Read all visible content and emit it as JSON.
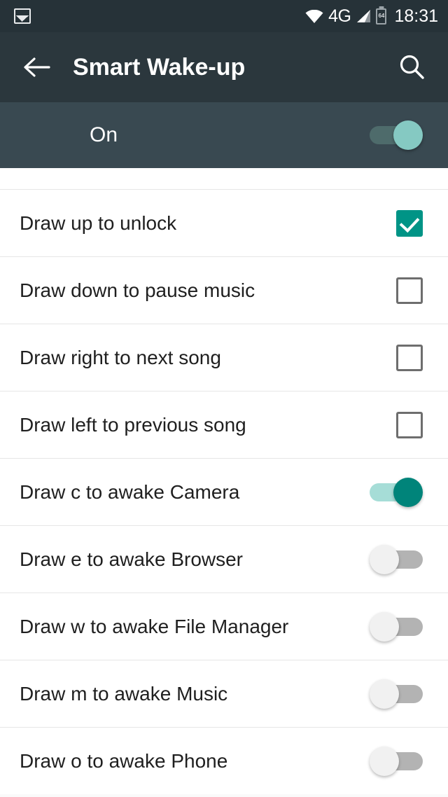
{
  "status_bar": {
    "notification_icon": "image-icon",
    "wifi_icon": "wifi-icon",
    "network_label": "4G",
    "signal_icon": "signal-bars-icon",
    "battery_icon": "battery-icon",
    "battery_level": "64",
    "time": "18:31"
  },
  "toolbar": {
    "back_icon": "back-arrow-icon",
    "title": "Smart Wake-up",
    "search_icon": "search-icon"
  },
  "master": {
    "label": "On",
    "state": "on"
  },
  "colors": {
    "status_bar_bg": "#263238",
    "toolbar_bg": "#2b373d",
    "master_band_bg": "#394951",
    "accent_teal": "#009486",
    "toggle_on_knob": "#00847a",
    "toggle_on_track": "#a6ddd7",
    "toggle_off_track": "#b3b3b3",
    "toggle_off_knob": "#f1f1f1",
    "master_knob": "#85c9c2",
    "master_track": "#4e6b6b",
    "divider": "#e6e6e6",
    "row_text": "#1f1f1f"
  },
  "rows": [
    {
      "label": "Draw up to unlock",
      "control": "checkbox",
      "state": "on"
    },
    {
      "label": "Draw down to pause music",
      "control": "checkbox",
      "state": "off"
    },
    {
      "label": "Draw right to next song",
      "control": "checkbox",
      "state": "off"
    },
    {
      "label": "Draw left to previous song",
      "control": "checkbox",
      "state": "off"
    },
    {
      "label": "Draw c to awake Camera",
      "control": "switch",
      "state": "on"
    },
    {
      "label": "Draw e to awake Browser",
      "control": "switch",
      "state": "off"
    },
    {
      "label": "Draw w to awake File Manager",
      "control": "switch",
      "state": "off"
    },
    {
      "label": "Draw m to awake Music",
      "control": "switch",
      "state": "off"
    },
    {
      "label": "Draw o to awake Phone",
      "control": "switch",
      "state": "off"
    }
  ]
}
